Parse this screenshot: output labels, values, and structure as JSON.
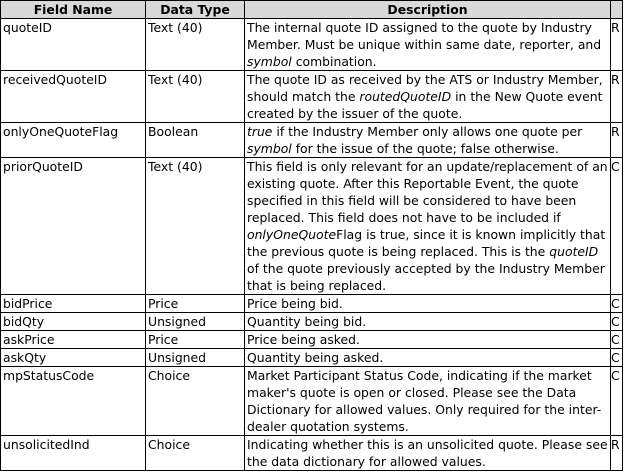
{
  "headers": [
    "Field Name",
    "Data Type",
    "Description",
    ""
  ],
  "rows": [
    {
      "field": "quoteID",
      "type": "Text (40)",
      "desc": [
        {
          "t": "The internal quote ID assigned to the quote by Industry Member. Must be unique within same date, reporter, and "
        },
        {
          "t": "symbol",
          "i": true
        },
        {
          "t": " combination."
        }
      ],
      "req": "R"
    },
    {
      "field": "receivedQuoteID",
      "type": "Text (40)",
      "desc": [
        {
          "t": "The quote ID as received by the ATS or Industry Member, should match the "
        },
        {
          "t": "routedQuoteID",
          "i": true
        },
        {
          "t": " in the New Quote event created by the issuer of the quote."
        }
      ],
      "req": "R"
    },
    {
      "field": "onlyOneQuoteFlag",
      "type": "Boolean",
      "desc": [
        {
          "t": "true",
          "i": true
        },
        {
          "t": " if the Industry Member only allows one quote per "
        },
        {
          "t": "symbol",
          "i": true
        },
        {
          "t": " for the issue of the quote; false otherwise."
        }
      ],
      "req": "R"
    },
    {
      "field": "priorQuoteID",
      "type": "Text (40)",
      "desc": [
        {
          "t": "This field is only relevant for an update/replacement of an existing quote. After this Reportable Event, the quote specified in this field will be considered to have been replaced. This field does not have to be included if "
        },
        {
          "t": "onlyOneQuote",
          "i": true
        },
        {
          "t": "Flag is true, since it is known implicitly that the previous quote is being replaced. This is the "
        },
        {
          "t": "quoteID",
          "i": true
        },
        {
          "t": " of the quote previously accepted by the Industry Member that is being replaced."
        }
      ],
      "req": "C"
    },
    {
      "field": "bidPrice",
      "type": "Price",
      "desc": [
        {
          "t": "Price being bid."
        }
      ],
      "req": "C"
    },
    {
      "field": "bidQty",
      "type": "Unsigned",
      "desc": [
        {
          "t": "Quantity being bid."
        }
      ],
      "req": "C"
    },
    {
      "field": "askPrice",
      "type": "Price",
      "desc": [
        {
          "t": "Price being asked."
        }
      ],
      "req": "C"
    },
    {
      "field": "askQty",
      "type": "Unsigned",
      "desc": [
        {
          "t": "Quantity being asked."
        }
      ],
      "req": "C"
    },
    {
      "field": "mpStatusCode",
      "type": "Choice",
      "desc": [
        {
          "t": "Market Participant Status Code, indicating if the market maker's quote is open or closed. Please see the Data Dictionary for allowed values. Only required for the inter-dealer quotation systems."
        }
      ],
      "req": "C"
    },
    {
      "field": "unsolicitedInd",
      "type": "Choice",
      "desc": [
        {
          "t": "Indicating whether this is an unsolicited quote. Please see the data dictionary for allowed values."
        }
      ],
      "req": "R"
    }
  ]
}
